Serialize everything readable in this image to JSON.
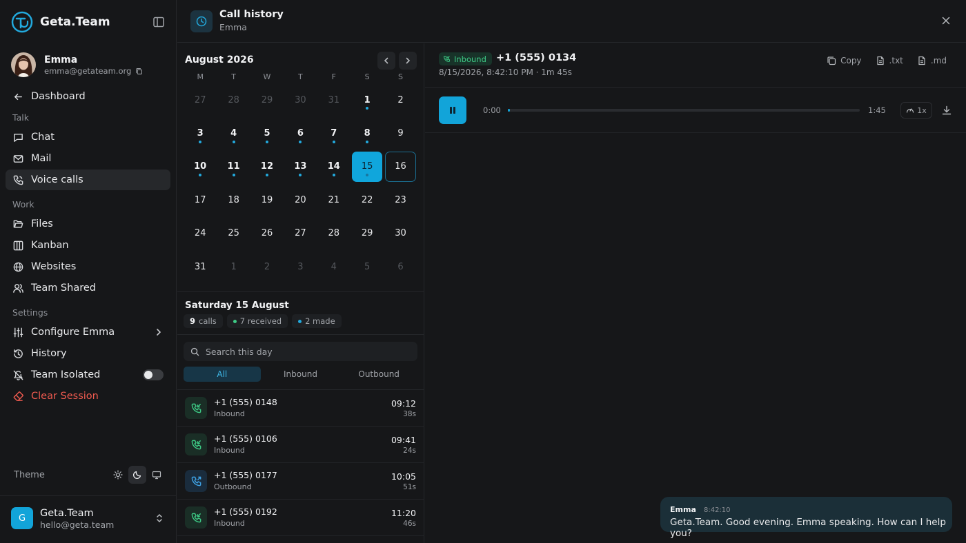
{
  "app": {
    "name": "Geta.Team"
  },
  "user": {
    "name": "Emma",
    "email": "emma@getateam.org"
  },
  "nav": {
    "dashboard": "Dashboard",
    "sections": {
      "talk": "Talk",
      "work": "Work",
      "settings": "Settings"
    },
    "talk_items": [
      "Chat",
      "Mail",
      "Voice calls"
    ],
    "work_items": [
      "Files",
      "Kanban",
      "Websites",
      "Team Shared"
    ],
    "settings_items": [
      "Configure Emma",
      "History",
      "Team Isolated",
      "Clear Session"
    ],
    "active": "Voice calls",
    "team_isolated_on": false
  },
  "theme": {
    "label": "Theme",
    "active": "dark"
  },
  "workspace": {
    "logo_letter": "G",
    "name": "Geta.Team",
    "email": "hello@geta.team"
  },
  "header": {
    "title": "Call history",
    "subtitle": "Emma"
  },
  "calendar": {
    "month_label": "August 2026",
    "weekdays": [
      "M",
      "T",
      "W",
      "T",
      "F",
      "S",
      "S"
    ],
    "days": [
      {
        "d": "27",
        "muted": true
      },
      {
        "d": "28",
        "muted": true
      },
      {
        "d": "29",
        "muted": true
      },
      {
        "d": "30",
        "muted": true
      },
      {
        "d": "31",
        "muted": true
      },
      {
        "d": "1",
        "bold": true,
        "dot": true
      },
      {
        "d": "2"
      },
      {
        "d": "3",
        "bold": true,
        "dot": true
      },
      {
        "d": "4",
        "bold": true,
        "dot": true
      },
      {
        "d": "5",
        "bold": true,
        "dot": true
      },
      {
        "d": "6",
        "bold": true,
        "dot": true
      },
      {
        "d": "7",
        "bold": true,
        "dot": true
      },
      {
        "d": "8",
        "bold": true,
        "dot": true
      },
      {
        "d": "9"
      },
      {
        "d": "10",
        "bold": true,
        "dot": true
      },
      {
        "d": "11",
        "bold": true,
        "dot": true
      },
      {
        "d": "12",
        "bold": true,
        "dot": true
      },
      {
        "d": "13",
        "bold": true,
        "dot": true
      },
      {
        "d": "14",
        "bold": true,
        "dot": true
      },
      {
        "d": "15",
        "selected": true,
        "dot": true
      },
      {
        "d": "16",
        "today": true
      },
      {
        "d": "17"
      },
      {
        "d": "18"
      },
      {
        "d": "19"
      },
      {
        "d": "20"
      },
      {
        "d": "21"
      },
      {
        "d": "22"
      },
      {
        "d": "23"
      },
      {
        "d": "24"
      },
      {
        "d": "25"
      },
      {
        "d": "26"
      },
      {
        "d": "27"
      },
      {
        "d": "28"
      },
      {
        "d": "29"
      },
      {
        "d": "30"
      },
      {
        "d": "31"
      },
      {
        "d": "1",
        "muted": true
      },
      {
        "d": "2",
        "muted": true
      },
      {
        "d": "3",
        "muted": true
      },
      {
        "d": "4",
        "muted": true
      },
      {
        "d": "5",
        "muted": true
      },
      {
        "d": "6",
        "muted": true
      }
    ]
  },
  "day_summary": {
    "title": "Saturday 15 August",
    "calls_count": "9",
    "calls_label": "calls",
    "received": "7 received",
    "made": "2 made",
    "received_color": "#3ecb86",
    "made_color": "#22a9dd"
  },
  "search": {
    "placeholder": "Search this day"
  },
  "filter_tabs": [
    "All",
    "Inbound",
    "Outbound"
  ],
  "active_filter": "All",
  "calls": [
    {
      "number": "+1 (555) 0148",
      "direction": "Inbound",
      "time": "09:12",
      "duration": "38s"
    },
    {
      "number": "+1 (555) 0106",
      "direction": "Inbound",
      "time": "09:41",
      "duration": "24s"
    },
    {
      "number": "+1 (555) 0177",
      "direction": "Outbound",
      "time": "10:05",
      "duration": "51s"
    },
    {
      "number": "+1 (555) 0192",
      "direction": "Inbound",
      "time": "11:20",
      "duration": "46s"
    }
  ],
  "detail": {
    "badge": "Inbound",
    "number": "+1 (555) 0134",
    "meta": "8/15/2026, 8:42:10 PM · 1m 45s",
    "actions": [
      "Copy",
      ".txt",
      ".md"
    ],
    "player": {
      "current": "0:00",
      "total": "1:45",
      "speed": "1x",
      "progress": 0.005
    }
  },
  "transcript": [
    {
      "sender": "Emma",
      "time": "8:42:10",
      "text": "Geta.Team. Good evening. Emma speaking. How can I help you?"
    }
  ],
  "colors": {
    "accent": "#12a4d9",
    "inbound": "#3ecb86",
    "outbound": "#3fa3e6",
    "danger": "#ef5a4f"
  }
}
